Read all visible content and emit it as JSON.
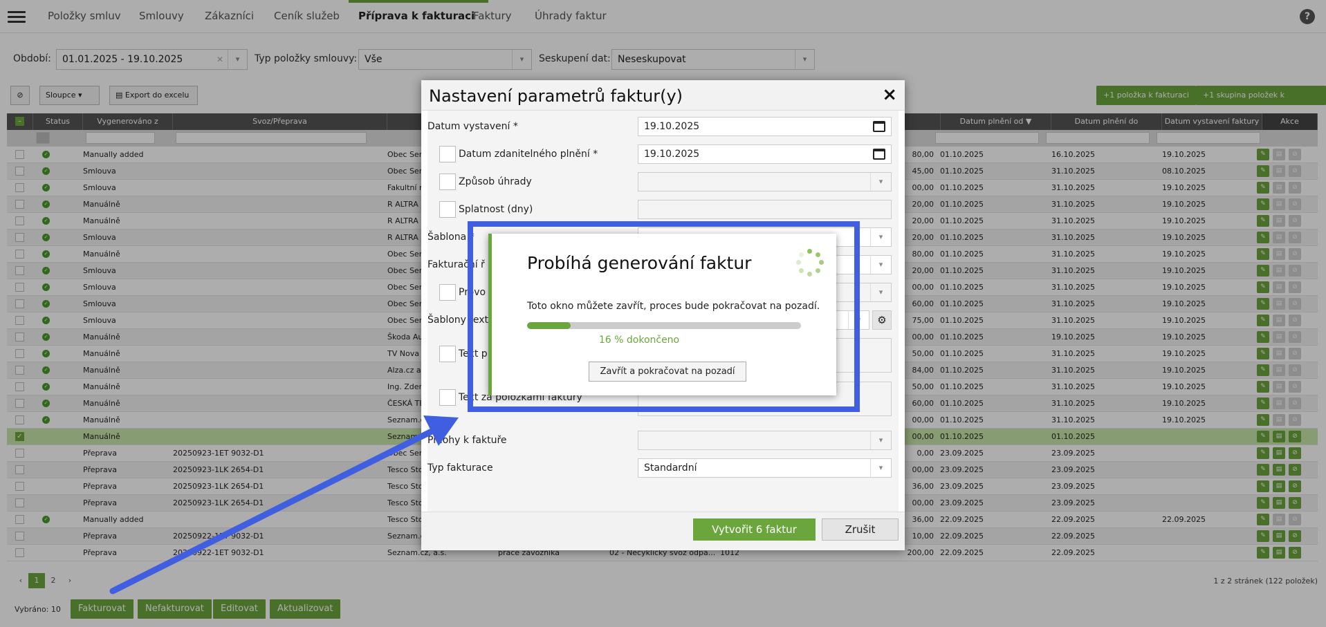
{
  "nav": {
    "items": [
      "Položky smluv",
      "Smlouvy",
      "Zákazníci",
      "Ceník služeb",
      "Příprava k fakturaci",
      "Faktury",
      "Úhrady faktur"
    ],
    "active": "Příprava k fakturaci",
    "help": "?"
  },
  "filters": {
    "period_label": "Období:",
    "period_value": "01.01.2025 - 19.10.2025",
    "type_label": "Typ položky smlouvy:",
    "type_value": "Vše",
    "group_label": "Seskupení dat:",
    "group_value": "Neseskupovat"
  },
  "toolbar": {
    "columns": "Sloupce",
    "export": "Export do excelu",
    "add_item": "+1 položka k fakturaci",
    "add_group": "+1 skupina položek k fakturaci"
  },
  "table": {
    "headers": [
      "Status",
      "Vygenerováno z",
      "Svoz/Přeprava",
      "Datum plnění od",
      "Datum plnění do",
      "Datum vystavení faktury",
      "Akce"
    ],
    "rows": [
      {
        "status": true,
        "source": "Manually added",
        "svoz": "",
        "cust": "Obec Sen",
        "amount": "80,00",
        "from": "01.10.2025",
        "to": "16.10.2025",
        "issued": "19.10.2025",
        "sel": false
      },
      {
        "status": true,
        "source": "Smlouva",
        "svoz": "",
        "cust": "Obec Sen",
        "amount": "45,00",
        "from": "01.10.2025",
        "to": "31.10.2025",
        "issued": "08.10.2025",
        "sel": false
      },
      {
        "status": true,
        "source": "Smlouva",
        "svoz": "",
        "cust": "Fakultní n",
        "amount": "00,00",
        "from": "01.10.2025",
        "to": "31.10.2025",
        "issued": "19.10.2025",
        "sel": false
      },
      {
        "status": true,
        "source": "Manuálně",
        "svoz": "",
        "cust": "R ALTRA s",
        "amount": "20,00",
        "from": "01.10.2025",
        "to": "31.10.2025",
        "issued": "19.10.2025",
        "sel": false
      },
      {
        "status": true,
        "source": "Manuálně",
        "svoz": "",
        "cust": "R ALTRA s",
        "amount": "20,00",
        "from": "01.10.2025",
        "to": "31.10.2025",
        "issued": "19.10.2025",
        "sel": false
      },
      {
        "status": true,
        "source": "Smlouva",
        "svoz": "",
        "cust": "R ALTRA s",
        "amount": "20,00",
        "from": "01.10.2025",
        "to": "31.10.2025",
        "issued": "19.10.2025",
        "sel": false
      },
      {
        "status": true,
        "source": "Manuálně",
        "svoz": "",
        "cust": "Obec Sen",
        "amount": "80,00",
        "from": "01.10.2025",
        "to": "31.10.2025",
        "issued": "19.10.2025",
        "sel": false
      },
      {
        "status": true,
        "source": "Smlouva",
        "svoz": "",
        "cust": "Obec Sen",
        "amount": "20,00",
        "from": "01.10.2025",
        "to": "31.10.2025",
        "issued": "19.10.2025",
        "sel": false
      },
      {
        "status": true,
        "source": "Smlouva",
        "svoz": "",
        "cust": "Obec Sen",
        "amount": "00,00",
        "from": "01.10.2025",
        "to": "31.10.2025",
        "issued": "19.10.2025",
        "sel": false
      },
      {
        "status": true,
        "source": "Smlouva",
        "svoz": "",
        "cust": "Obec Sen",
        "amount": "60,00",
        "from": "01.10.2025",
        "to": "31.10.2025",
        "issued": "19.10.2025",
        "sel": false
      },
      {
        "status": true,
        "source": "Smlouva",
        "svoz": "",
        "cust": "Obec Sen",
        "amount": "75,00",
        "from": "01.10.2025",
        "to": "31.10.2025",
        "issued": "19.10.2025",
        "sel": false
      },
      {
        "status": true,
        "source": "Manuálně",
        "svoz": "",
        "cust": "Škoda Au",
        "amount": "00,00",
        "from": "01.10.2025",
        "to": "19.10.2025",
        "issued": "19.10.2025",
        "sel": false
      },
      {
        "status": true,
        "source": "Manuálně",
        "svoz": "",
        "cust": "TV Nova s",
        "amount": "50,00",
        "from": "01.10.2025",
        "to": "31.10.2025",
        "issued": "19.10.2025",
        "sel": false
      },
      {
        "status": true,
        "source": "Manuálně",
        "svoz": "",
        "cust": "Alza.cz a.s",
        "amount": "84,00",
        "from": "01.10.2025",
        "to": "31.10.2025",
        "issued": "19.10.2025",
        "sel": false
      },
      {
        "status": true,
        "source": "Manuálně",
        "svoz": "",
        "cust": "Ing. Zden",
        "amount": "50,00",
        "from": "01.10.2025",
        "to": "31.10.2025",
        "issued": "19.10.2025",
        "sel": false
      },
      {
        "status": true,
        "source": "Manuálně",
        "svoz": "",
        "cust": "ČESKÁ TE",
        "amount": "60,00",
        "from": "01.10.2025",
        "to": "31.10.2025",
        "issued": "19.10.2025",
        "sel": false
      },
      {
        "status": true,
        "source": "Manuálně",
        "svoz": "",
        "cust": "Seznam.c",
        "amount": "00,00",
        "from": "01.10.2025",
        "to": "31.10.2025",
        "issued": "19.10.2025",
        "sel": false
      },
      {
        "status": false,
        "source": "Manuálně",
        "svoz": "",
        "cust": "Seznam",
        "amount": "00,00",
        "from": "01.10.2025",
        "to": "01.10.2025",
        "issued": "",
        "sel": true
      },
      {
        "status": false,
        "source": "Přeprava",
        "svoz": "20250923-1ET 9032-D1",
        "cust": "Obec Sen",
        "amount": "0,00",
        "from": "23.09.2025",
        "to": "23.09.2025",
        "issued": "",
        "sel": false
      },
      {
        "status": false,
        "source": "Přeprava",
        "svoz": "20250923-1LK 2654-D1",
        "cust": "Tesco Sto",
        "amount": "00,00",
        "from": "23.09.2025",
        "to": "23.09.2025",
        "issued": "",
        "sel": false
      },
      {
        "status": false,
        "source": "Přeprava",
        "svoz": "20250923-1LK 2654-D1",
        "cust": "Tesco Sto",
        "amount": "36,00",
        "from": "23.09.2025",
        "to": "23.09.2025",
        "issued": "",
        "sel": false
      },
      {
        "status": false,
        "source": "Přeprava",
        "svoz": "20250923-1LK 2654-D1",
        "cust": "Tesco Sto",
        "amount": "00,00",
        "from": "23.09.2025",
        "to": "23.09.2025",
        "issued": "",
        "sel": false
      },
      {
        "status": true,
        "source": "Manually added",
        "svoz": "",
        "cust": "Tesco Sto",
        "amount": "36,00",
        "from": "22.09.2025",
        "to": "22.09.2025",
        "issued": "22.09.2025",
        "sel": false
      },
      {
        "status": false,
        "source": "Přeprava",
        "svoz": "20250922-1ET 9032-D1",
        "cust": "Seznam.c",
        "amount": "10,00",
        "from": "22.09.2025",
        "to": "22.09.2025",
        "issued": "",
        "sel": false
      },
      {
        "status": false,
        "source": "Přeprava",
        "svoz": "20250922-1ET 9032-D1",
        "cust": "Seznam.cz, a.s.",
        "amount": "200,00",
        "from": "22.09.2025",
        "to": "22.09.2025",
        "issued": "",
        "sel": false,
        "extra1": "práce závozníka",
        "extra2": "02 - Necyklický svoz odpa...",
        "extra3": "1012"
      }
    ]
  },
  "pager": {
    "pages": [
      "1",
      "2"
    ],
    "current": "1",
    "info": "1 z 2 stránek (122 položek)"
  },
  "bottom": {
    "selected": "Vybráno: 10",
    "buttons": [
      "Fakturovat",
      "Nefakturovat",
      "Editovat",
      "Aktualizovat"
    ]
  },
  "modal": {
    "title": "Nastavení parametrů faktur(y)",
    "close": "×",
    "fields": {
      "issue_date_label": "Datum vystavení *",
      "issue_date_value": "19.10.2025",
      "tax_date_label": "Datum zdanitelného plnění *",
      "tax_date_value": "19.10.2025",
      "payment_label": "Způsob úhrady",
      "due_label": "Splatnost (dny)",
      "template_label": "Šablona *",
      "invoicing_label": "Fakturační ř",
      "prov_label": "Provo",
      "text_templates_label": "Šablony text",
      "text_before_label": "Text p",
      "text_after_label": "Text za položkami faktury",
      "attachments_label": "Přílohy k faktuře",
      "invoicing_type_label": "Typ fakturace",
      "invoicing_type_value": "Standardní"
    },
    "create_button": "Vytvořit 6 faktur",
    "cancel_button": "Zrušit"
  },
  "progress": {
    "title": "Probíhá generování faktur",
    "message": "Toto okno můžete zavřít, proces bude pokračovat na pozadí.",
    "percent": 16,
    "percent_text": "16 % dokončeno",
    "button": "Zavřít a pokračovat na pozadí"
  },
  "colors": {
    "accent": "#6aa63c",
    "highlight": "#3f5fe0",
    "header": "#555555"
  }
}
